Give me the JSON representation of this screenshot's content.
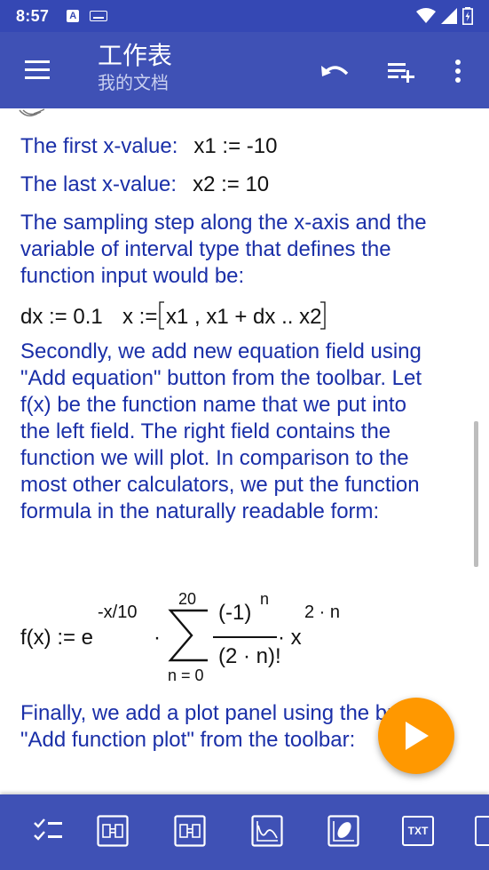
{
  "status": {
    "time": "8:57",
    "notification_a": "A"
  },
  "appbar": {
    "title": "工作表",
    "subtitle": "我的文档"
  },
  "content": {
    "first_label": "The first x-value:",
    "first_expr": "x1 := -10",
    "last_label": "The last x-value:",
    "last_expr": "x2 := 10",
    "sampling_text": "The sampling step along the x-axis and the variable of interval type that defines the function input would be:",
    "dx_expr": "dx := 0.1",
    "x_lhs": "x :=",
    "x_interval": "x1 , x1 + dx .. x2",
    "secondly_text": "Secondly, we add new equation field using \"Add equation\" button from the toolbar. Let f(x) be the function name that we put into the left field. The right field contains the function we will plot. In comparison to the most other calculators, we put the function formula in the naturally readable form:",
    "formula": {
      "lhs": "f(x) := e",
      "exp_sup": "-x/10",
      "dot": "·",
      "sum_upper": "20",
      "sum_lower": "n = 0",
      "numerator_base": "(-1)",
      "numerator_sup": "n",
      "denominator": "(2 · n)!",
      "times_x": "· x",
      "x_sup": "2 · n"
    },
    "finally_text": "Finally, we add a plot panel using the button \"Add function plot\" from the toolbar:"
  },
  "bottombar": {
    "txt_label": "TXT"
  },
  "colors": {
    "primary": "#3f51b5",
    "status_bar": "#3548b4",
    "accent": "#ff9800",
    "text_blue": "#1a2fa8"
  }
}
